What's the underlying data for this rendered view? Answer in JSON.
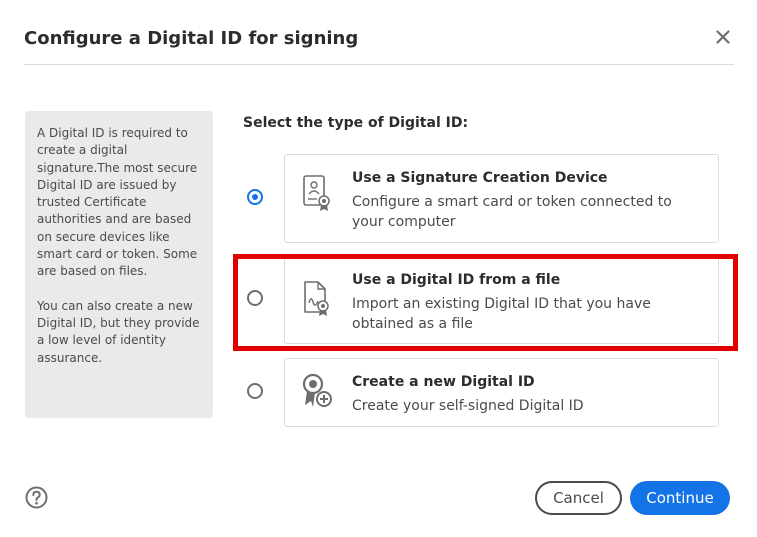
{
  "dialog": {
    "title": "Configure a Digital ID for signing",
    "close_icon": "close-icon"
  },
  "info_panel": {
    "paragraph1": "A Digital ID is required to create a digital signature.The most secure Digital ID are issued by trusted Certificate authorities and are based on secure devices like smart card or token. Some are based on files.",
    "paragraph2": "You can also create a new Digital ID, but they provide a low level of identity assurance."
  },
  "section_label": "Select the type of Digital ID:",
  "options": [
    {
      "title": "Use a Signature Creation Device",
      "description": "Configure a smart card or token connected to your computer",
      "icon": "smart-card-icon",
      "selected": true
    },
    {
      "title": "Use a Digital ID from a file",
      "description": "Import an existing Digital ID that you have obtained as a file",
      "icon": "certificate-file-icon",
      "selected": false
    },
    {
      "title": "Create a new Digital ID",
      "description": "Create your self-signed Digital ID",
      "icon": "new-id-badge-icon",
      "selected": false
    }
  ],
  "footer": {
    "help_icon": "help-icon",
    "cancel_label": "Cancel",
    "continue_label": "Continue"
  },
  "colors": {
    "accent": "#1473e6",
    "highlight": "#e00000",
    "panel_bg": "#eaeaea"
  }
}
